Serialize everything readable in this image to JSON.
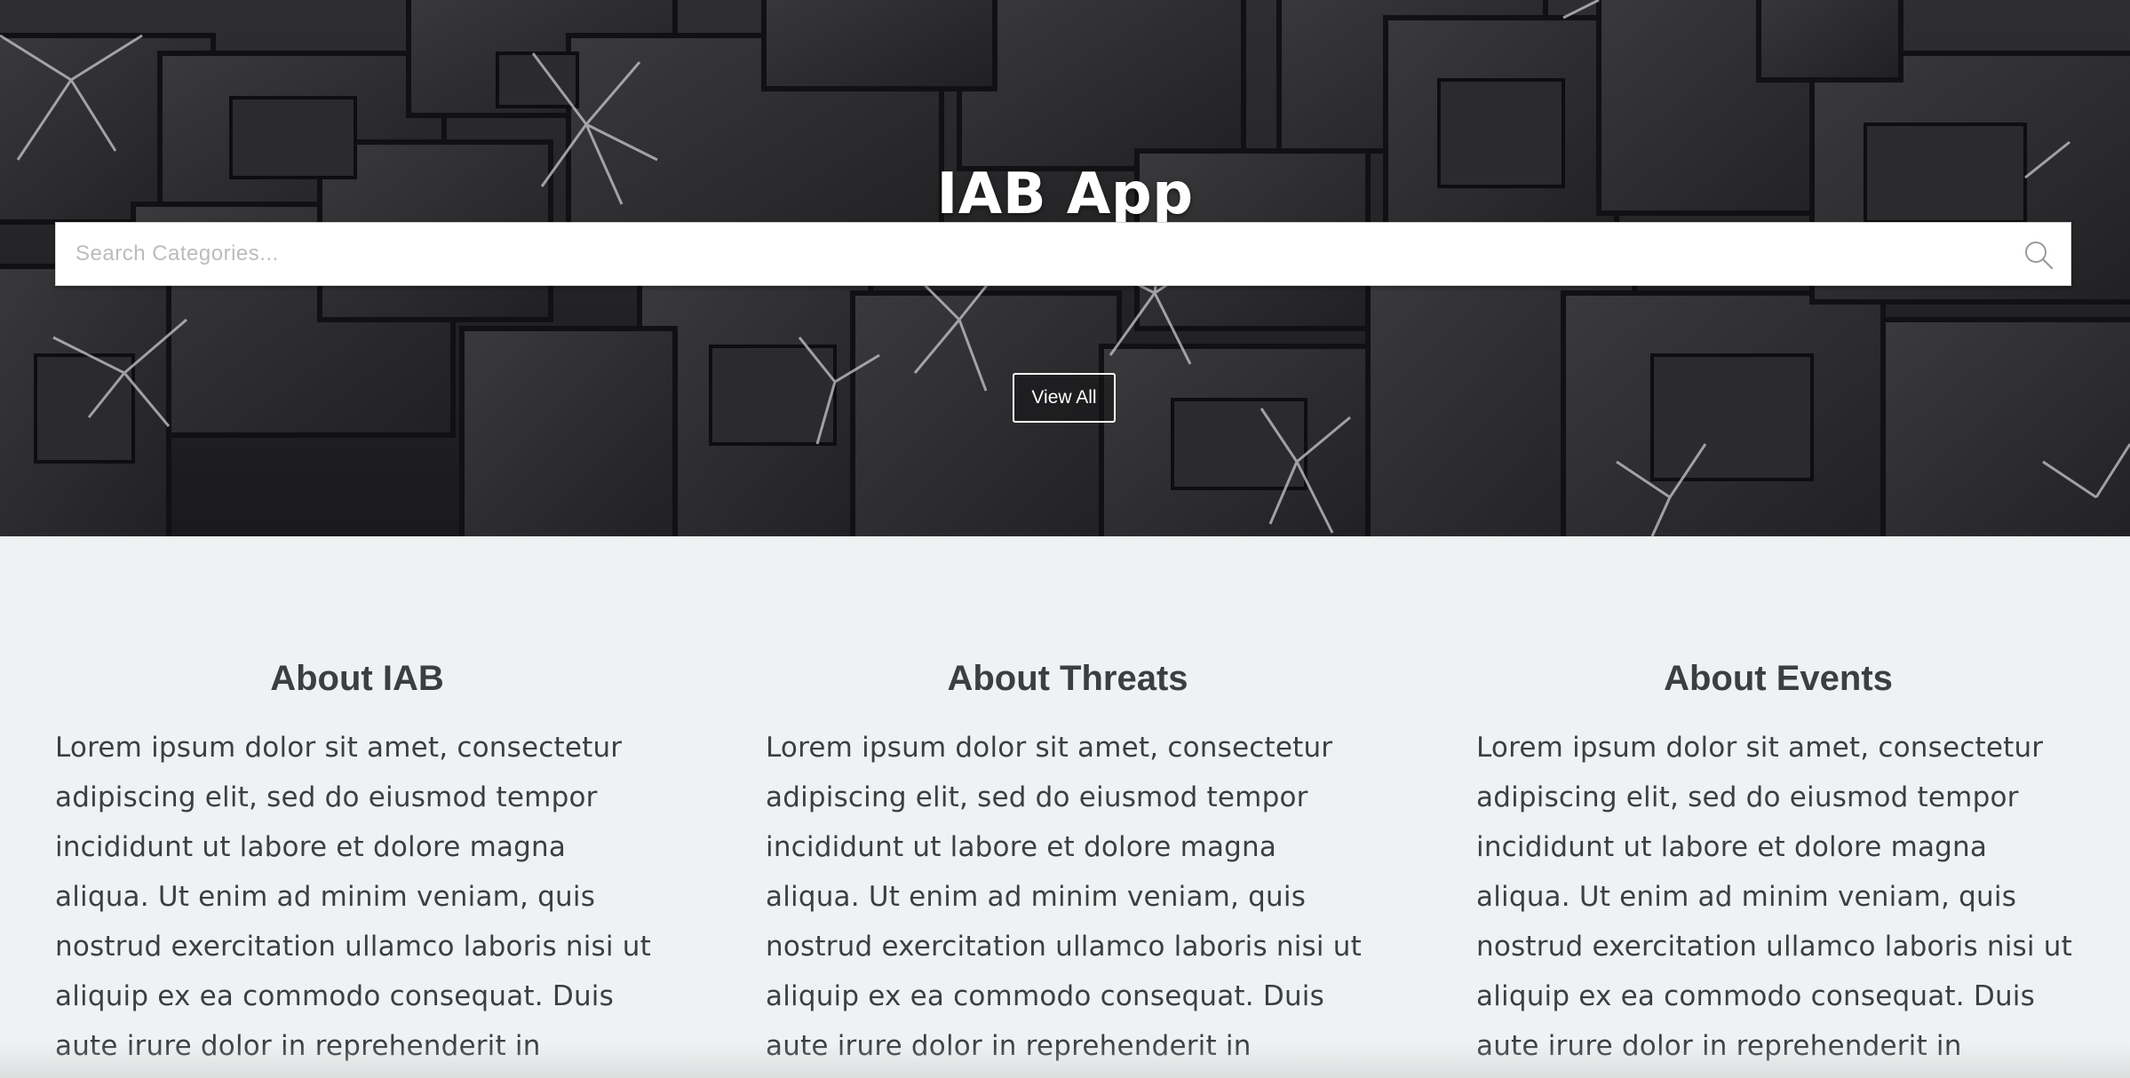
{
  "hero": {
    "title": "IAB App",
    "search_placeholder": "Search Categories...",
    "view_all_label": "View All"
  },
  "about": [
    {
      "heading": "About IAB",
      "body": "Lorem ipsum dolor sit amet, consectetur adipiscing elit, sed do eiusmod tempor incididunt ut labore et dolore magna aliqua. Ut enim ad minim veniam, quis nostrud exercitation ullamco laboris nisi ut aliquip ex ea commodo consequat. Duis aute irure dolor in reprehenderit in voluptate velit"
    },
    {
      "heading": "About Threats",
      "body": "Lorem ipsum dolor sit amet, consectetur adipiscing elit, sed do eiusmod tempor incididunt ut labore et dolore magna aliqua. Ut enim ad minim veniam, quis nostrud exercitation ullamco laboris nisi ut aliquip ex ea commodo consequat. Duis aute irure dolor in reprehenderit in voluptate velit"
    },
    {
      "heading": "About Events",
      "body": "Lorem ipsum dolor sit amet, consectetur adipiscing elit, sed do eiusmod tempor incididunt ut labore et dolore magna aliqua. Ut enim ad minim veniam, quis nostrud exercitation ullamco laboris nisi ut aliquip ex ea commodo consequat. Duis aute irure dolor in reprehenderit in voluptate velit"
    }
  ],
  "colors": {
    "hero_bg": "#1f1f21",
    "section_bg": "#eff2f2",
    "text": "#3b3f40",
    "white": "#ffffff"
  },
  "icons": {
    "search": "search-icon"
  }
}
